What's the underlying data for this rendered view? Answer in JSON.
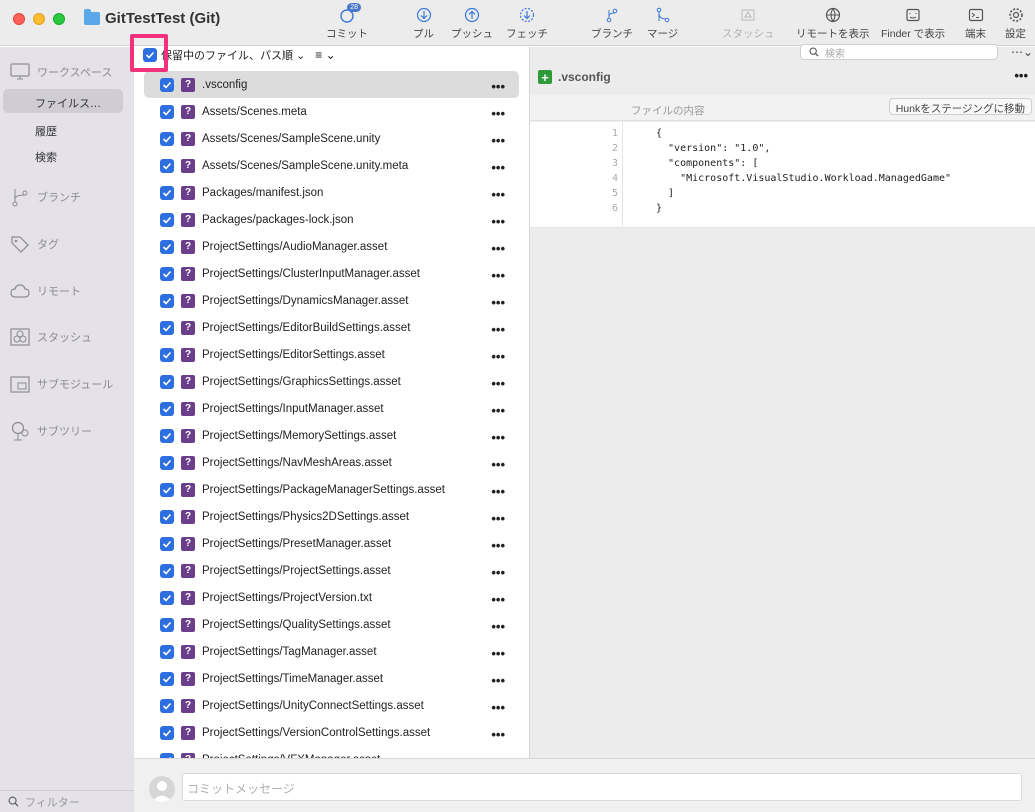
{
  "window": {
    "title": "GitTestTest (Git)"
  },
  "toolbar": {
    "commit": {
      "label": "コミット",
      "badge": "28"
    },
    "pull": "プル",
    "push": "プッシュ",
    "fetch": "フェッチ",
    "branch": "ブランチ",
    "merge": "マージ",
    "stash": "スタッシュ",
    "show_remote": "リモートを表示",
    "show_in_finder": "Finder で表示",
    "terminal": "端末",
    "settings": "設定"
  },
  "sidebar": {
    "workspace": "ワークスペース",
    "workspace_items": [
      "ファイルス…",
      "履歴",
      "検索"
    ],
    "branches": "ブランチ",
    "tags": "タグ",
    "remotes": "リモート",
    "stashes": "スタッシュ",
    "submodules": "サブモジュール",
    "subtrees": "サブツリー",
    "filter_placeholder": "フィルター"
  },
  "file_list": {
    "sort_label": "保留中のファイル、パス順",
    "files": [
      ".vsconfig",
      "Assets/Scenes.meta",
      "Assets/Scenes/SampleScene.unity",
      "Assets/Scenes/SampleScene.unity.meta",
      "Packages/manifest.json",
      "Packages/packages-lock.json",
      "ProjectSettings/AudioManager.asset",
      "ProjectSettings/ClusterInputManager.asset",
      "ProjectSettings/DynamicsManager.asset",
      "ProjectSettings/EditorBuildSettings.asset",
      "ProjectSettings/EditorSettings.asset",
      "ProjectSettings/GraphicsSettings.asset",
      "ProjectSettings/InputManager.asset",
      "ProjectSettings/MemorySettings.asset",
      "ProjectSettings/NavMeshAreas.asset",
      "ProjectSettings/PackageManagerSettings.asset",
      "ProjectSettings/Physics2DSettings.asset",
      "ProjectSettings/PresetManager.asset",
      "ProjectSettings/ProjectSettings.asset",
      "ProjectSettings/ProjectVersion.txt",
      "ProjectSettings/QualitySettings.asset",
      "ProjectSettings/TagManager.asset",
      "ProjectSettings/TimeManager.asset",
      "ProjectSettings/UnityConnectSettings.asset",
      "ProjectSettings/VersionControlSettings.asset",
      "ProjectSettings/VFXManager.asset"
    ],
    "status_glyph": "?",
    "more_glyph": "•••"
  },
  "diff": {
    "search_placeholder": "検索",
    "file_title": ".vsconfig",
    "content_label": "ファイルの内容",
    "hunk_button": "Hunkをステージングに移動",
    "lines": [
      {
        "num": "1",
        "text": "{"
      },
      {
        "num": "2",
        "text": "  \"version\": \"1.0\","
      },
      {
        "num": "3",
        "text": "  \"components\": ["
      },
      {
        "num": "4",
        "text": "    \"Microsoft.VisualStudio.Workload.ManagedGame\""
      },
      {
        "num": "5",
        "text": "  ]"
      },
      {
        "num": "6",
        "text": "}"
      }
    ]
  },
  "commit": {
    "placeholder": "コミットメッセージ"
  },
  "colors": {
    "accent": "#2d6fe0",
    "highlight": "#f2317c",
    "untracked": "#6b3e8c",
    "added": "#2f9a3a"
  }
}
